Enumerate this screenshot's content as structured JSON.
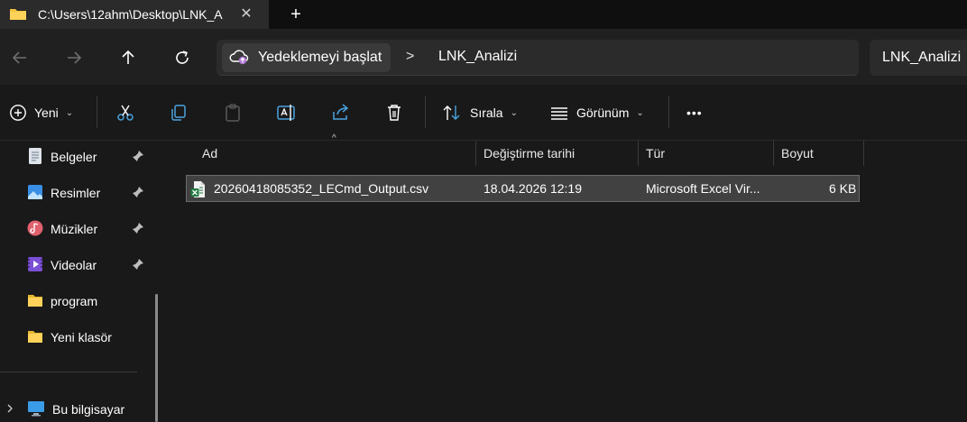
{
  "window": {
    "tab_title": "C:\\Users\\12ahm\\Desktop\\LNK_Analizi",
    "close_glyph": "✕",
    "new_tab_glyph": "+"
  },
  "address": {
    "root_label": "Yedeklemeyi başlat",
    "separator": ">",
    "current_folder": "LNK_Analizi",
    "search_text": "LNK_Analizi"
  },
  "toolbar": {
    "new_label": "Yeni",
    "sort_label": "Sırala",
    "view_label": "Görünüm",
    "more_label": "•••",
    "chevron": "⌄"
  },
  "sidebar": {
    "items": [
      {
        "label": "Belgeler",
        "icon": "documents-icon",
        "pinned": true
      },
      {
        "label": "Resimler",
        "icon": "pictures-icon",
        "pinned": true
      },
      {
        "label": "Müzikler",
        "icon": "music-icon",
        "pinned": true
      },
      {
        "label": "Videolar",
        "icon": "videos-icon",
        "pinned": true
      },
      {
        "label": "program",
        "icon": "folder-icon",
        "pinned": false
      },
      {
        "label": "Yeni klasör",
        "icon": "folder-icon",
        "pinned": false
      }
    ],
    "this_pc_label": "Bu bilgisayar"
  },
  "table": {
    "sort_indicator": "^",
    "columns": [
      "Ad",
      "Değiştirme tarihi",
      "Tür",
      "Boyut"
    ],
    "rows": [
      {
        "name": "20260418085352_LECmd_Output.csv",
        "modified": "18.04.2026 12:19",
        "type": "Microsoft Excel Vir...",
        "size": "6 KB"
      }
    ]
  },
  "colors": {
    "window_bg": "#191919",
    "titlebar_bg": "#0f0f0f",
    "tab_bg": "#2b2b2b",
    "selected_row_bg": "#414141",
    "folder_yellow": "#f4c542",
    "excel_green": "#1f7a3e"
  }
}
